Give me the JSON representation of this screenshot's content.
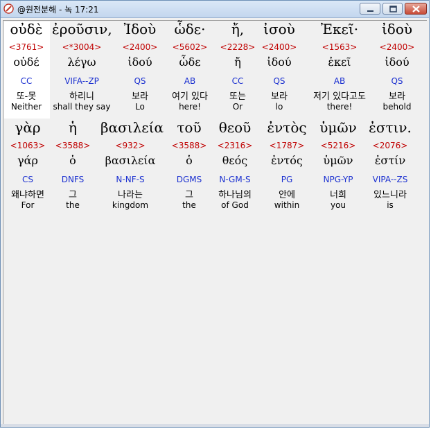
{
  "window": {
    "title": "@원전분해 - 녹 17:21",
    "buttons": [
      "minimize",
      "maximize",
      "close"
    ]
  },
  "rows": [
    {
      "words": [
        {
          "greek": "οὐδὲ",
          "strong": "<3761>",
          "lemma": "οὐδέ",
          "parse": "CC",
          "korean": "또-못",
          "english": "Neither"
        },
        {
          "greek": "ἐροῦσιν,",
          "strong": "<*3004>",
          "lemma": "λέγω",
          "parse": "VIFA--ZP",
          "korean": "하리니",
          "english": "shall they say"
        },
        {
          "greek": "Ἰδοὺ",
          "strong": "<2400>",
          "lemma": "ἰδού",
          "parse": "QS",
          "korean": "보라",
          "english": "Lo"
        },
        {
          "greek": "ὧδε·",
          "strong": "<5602>",
          "lemma": "ὧδε",
          "parse": "AB",
          "korean": "여기 있다",
          "english": "here!"
        },
        {
          "greek": "ἤ,",
          "strong": "<2228>",
          "lemma": "ἤ",
          "parse": "CC",
          "korean": "또는",
          "english": "Or"
        },
        {
          "greek": "ἰσοὺ",
          "strong": "<2400>",
          "lemma": "ἰδού",
          "parse": "QS",
          "korean": "보라",
          "english": "lo"
        },
        {
          "greek": "Ἐκεῖ·",
          "strong": "<1563>",
          "lemma": "ἐκεῖ",
          "parse": "AB",
          "korean": "저기 있다고도",
          "english": "there!"
        },
        {
          "greek": "ἰδοὺ",
          "strong": "<2400>",
          "lemma": "ἰδού",
          "parse": "QS",
          "korean": "보라",
          "english": "behold"
        }
      ]
    },
    {
      "words": [
        {
          "greek": "γὰρ",
          "strong": "<1063>",
          "lemma": "γάρ",
          "parse": "CS",
          "korean": "왜냐하면",
          "english": "For"
        },
        {
          "greek": "ἡ",
          "strong": "<3588>",
          "lemma": "ὁ",
          "parse": "DNFS",
          "korean": "그",
          "english": "the"
        },
        {
          "greek": "βασιλεία",
          "strong": "<932>",
          "lemma": "βασιλεία",
          "parse": "N-NF-S",
          "korean": "나라는",
          "english": "kingdom"
        },
        {
          "greek": "τοῦ",
          "strong": "<3588>",
          "lemma": "ὁ",
          "parse": "DGMS",
          "korean": "그",
          "english": "the"
        },
        {
          "greek": "θεοῦ",
          "strong": "<2316>",
          "lemma": "θεός",
          "parse": "N-GM-S",
          "korean": "하나님의",
          "english": "of God"
        },
        {
          "greek": "ἐντὸς",
          "strong": "<1787>",
          "lemma": "ἐντός",
          "parse": "PG",
          "korean": "안에",
          "english": "within"
        },
        {
          "greek": "ὑμῶν",
          "strong": "<5216>",
          "lemma": "ὑμῶν",
          "parse": "NPG-YP",
          "korean": "너희",
          "english": "you"
        },
        {
          "greek": "ἐστιν.",
          "strong": "<2076>",
          "lemma": "ἐστίν",
          "parse": "VIPA--ZS",
          "korean": "있느니라",
          "english": "is"
        }
      ]
    }
  ]
}
